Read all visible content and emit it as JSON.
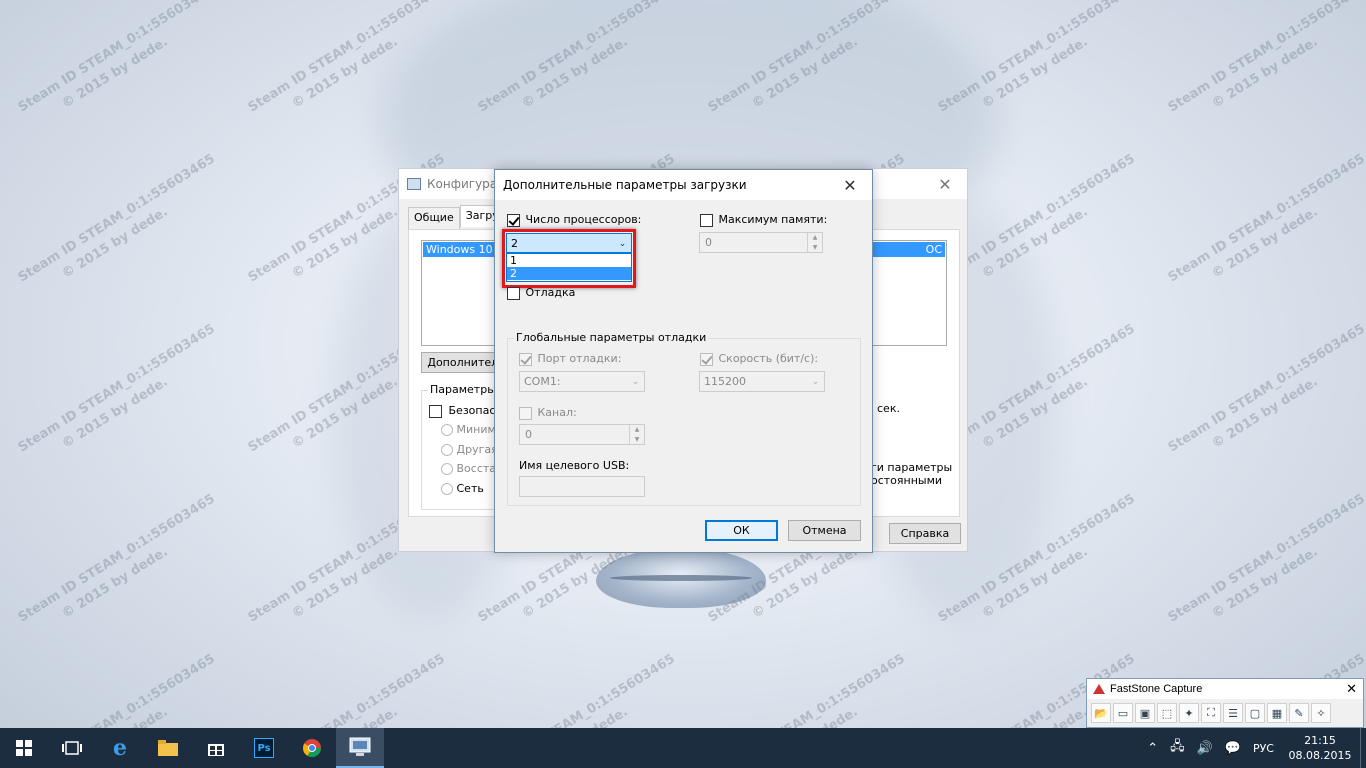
{
  "watermark": {
    "line1": "Steam ID  STEAM_0:1:55603465",
    "line2": "© 2015 by dede."
  },
  "back_window": {
    "title": "Конфигурац",
    "tabs": [
      "Общие",
      "Загруз"
    ],
    "os_list_selected": "Windows 10 (C",
    "os_list_selected_right": "ОС",
    "advanced_button": "Дополнитель",
    "boot_params_label": "Параметры з",
    "safe_mode_label": "Безопасны",
    "radio_options": [
      "Минима",
      "Другая",
      "Восстан",
      "Сеть"
    ],
    "right_fragment_sec": "сек.",
    "right_fragment_params1": "ги параметры",
    "right_fragment_params2": "остоянными",
    "help_button": "Справка",
    "colors": {
      "selection": "#3399ff"
    }
  },
  "dialog": {
    "title": "Дополнительные параметры загрузки",
    "cpu_count_label": "Число процессоров:",
    "cpu_count_checked": true,
    "cpu_count_value": "2",
    "cpu_options": [
      "1",
      "2"
    ],
    "cpu_selected_option": "2",
    "max_memory_label": "Максимум памяти:",
    "max_memory_checked": false,
    "max_memory_value": "0",
    "debug_label": "Отладка",
    "debug_checked": false,
    "global_debug_group": "Глобальные параметры отладки",
    "debug_port_label": "Порт отладки:",
    "debug_port_value": "COM1:",
    "baud_label": "Скорость (бит/с):",
    "baud_value": "115200",
    "channel_label": "Канал:",
    "channel_value": "0",
    "usb_target_label": "Имя целевого USB:",
    "usb_target_value": "",
    "ok_button": "ОК",
    "cancel_button": "Отмена",
    "colors": {
      "highlight_frame": "#e0191e",
      "primary": "#0078d7"
    }
  },
  "faststone": {
    "title": "FastStone Capture"
  },
  "taskbar": {
    "language": "РУС",
    "time": "21:15",
    "date": "08.08.2015",
    "apps": [
      "start",
      "task-view",
      "edge",
      "file-explorer",
      "store",
      "photoshop",
      "chrome",
      "msconfig"
    ]
  }
}
